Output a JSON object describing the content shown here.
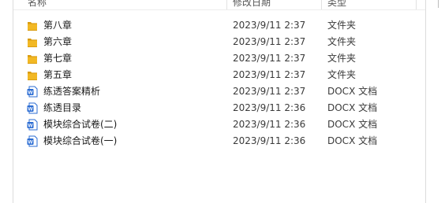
{
  "header": {
    "name": "名称",
    "date": "修改日期",
    "type": "类型"
  },
  "files": [
    {
      "name": "第八章",
      "date": "2023/9/11 2:37",
      "type": "文件夹",
      "icon": "folder-icon"
    },
    {
      "name": "第六章",
      "date": "2023/9/11 2:37",
      "type": "文件夹",
      "icon": "folder-icon"
    },
    {
      "name": "第七章",
      "date": "2023/9/11 2:37",
      "type": "文件夹",
      "icon": "folder-icon"
    },
    {
      "name": "第五章",
      "date": "2023/9/11 2:37",
      "type": "文件夹",
      "icon": "folder-icon"
    },
    {
      "name": "练透答案精析",
      "date": "2023/9/11 2:37",
      "type": "DOCX 文档",
      "icon": "word-doc-icon"
    },
    {
      "name": "练透目录",
      "date": "2023/9/11 2:36",
      "type": "DOCX 文档",
      "icon": "word-doc-icon"
    },
    {
      "name": "模块综合试卷(二)",
      "date": "2023/9/11 2:36",
      "type": "DOCX 文档",
      "icon": "word-doc-icon"
    },
    {
      "name": "模块综合试卷(一)",
      "date": "2023/9/11 2:36",
      "type": "DOCX 文档",
      "icon": "word-doc-icon"
    }
  ],
  "colors": {
    "folder": "#f2b824",
    "word_blue": "#2b6cd3"
  }
}
